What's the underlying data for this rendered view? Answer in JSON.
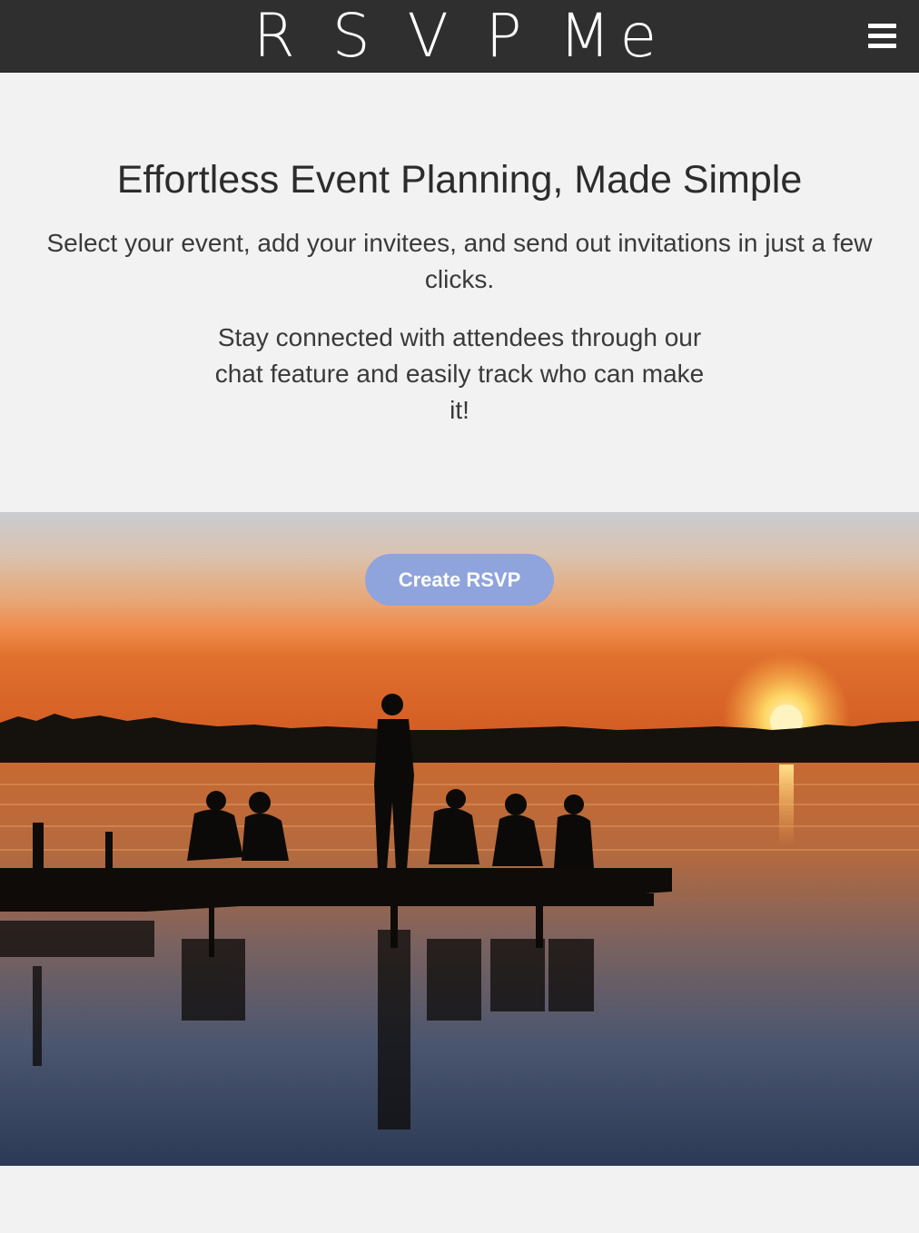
{
  "app": {
    "brand": "R S V P Me"
  },
  "header": {
    "menu_icon": "hamburger-menu-icon"
  },
  "intro": {
    "headline": "Effortless Event Planning, Made Simple",
    "line1": "Select your event, add your invitees, and send out invitations in just a few clicks.",
    "line2": "Stay connected with attendees through our chat feature and easily track who can make it!"
  },
  "hero": {
    "cta_label": "Create RSVP",
    "image": "sunset-lake-dock-silhouettes-image"
  },
  "colors": {
    "header_bg": "#2f2f2f",
    "page_bg": "#f2f2f2",
    "cta_bg": "#8fa3dc",
    "cta_text": "#ffffff"
  }
}
